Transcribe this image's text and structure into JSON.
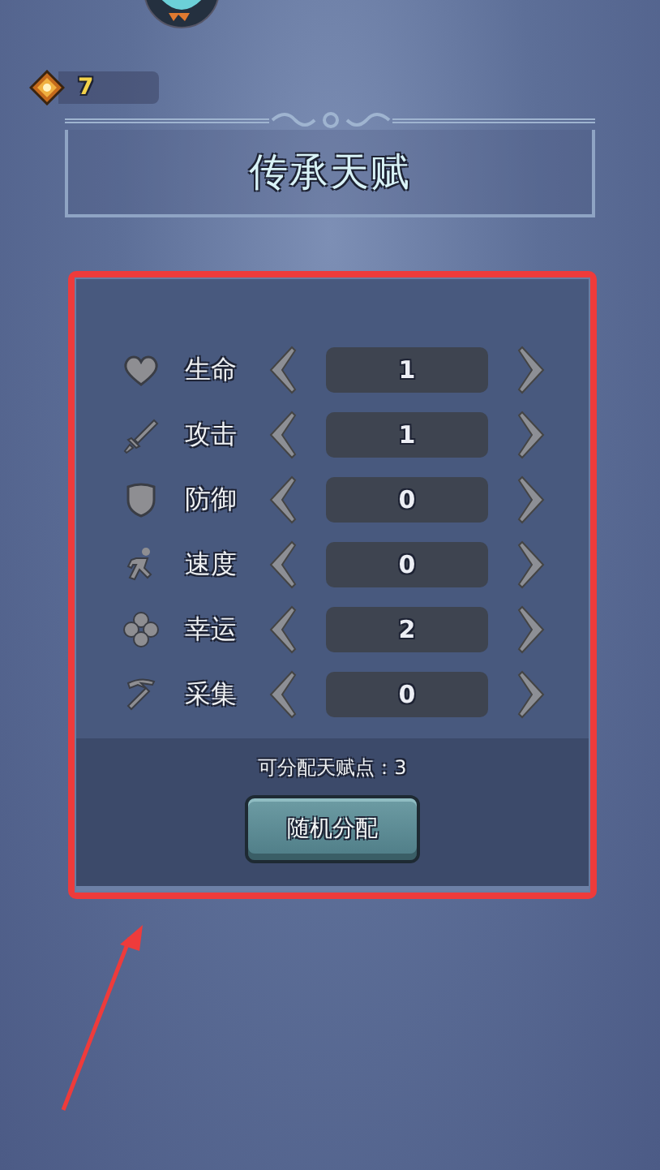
{
  "currency": {
    "amount": "7"
  },
  "title": "传承天赋",
  "talents": [
    {
      "name": "生命",
      "value": "1"
    },
    {
      "name": "攻击",
      "value": "1"
    },
    {
      "name": "防御",
      "value": "0"
    },
    {
      "name": "速度",
      "value": "0"
    },
    {
      "name": "幸运",
      "value": "2"
    },
    {
      "name": "采集",
      "value": "0"
    }
  ],
  "points_label": "可分配天赋点：3",
  "random_button": "随机分配"
}
